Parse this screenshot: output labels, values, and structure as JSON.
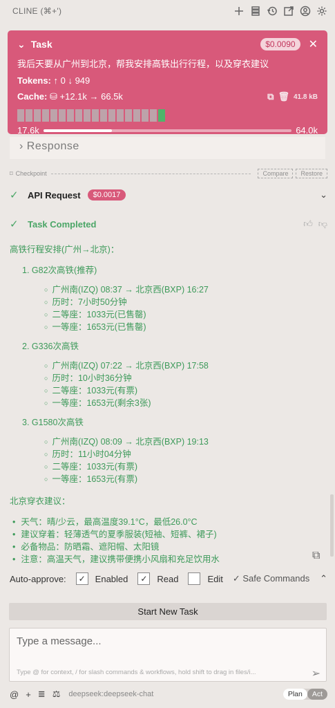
{
  "header": {
    "title": "CLINE (⌘+')"
  },
  "task": {
    "label": "Task",
    "cost": "$0.0090",
    "description": "我后天要从广州到北京，帮我安排高铁出行行程，以及穿衣建议",
    "tokens_label": "Tokens:",
    "tokens_value": "↑ 0 ↓ 949",
    "cache_label": "Cache:",
    "cache_value": "+12.1k → 66.5k",
    "size": "41.8 kB",
    "context_used": "17.6k",
    "context_max": "64.0k",
    "context_fraction": 0.275,
    "blocks": [
      "dim",
      "dim",
      "dim",
      "dim",
      "dim",
      "dim",
      "dim",
      "dim",
      "dim",
      "dim",
      "dim",
      "dim",
      "dim",
      "dim",
      "dim",
      "dim",
      "dim",
      "green"
    ]
  },
  "response": {
    "label": "Response"
  },
  "checkpoint": {
    "label": "Checkpoint",
    "compare": "Compare",
    "restore": "Restore"
  },
  "api_request": {
    "label": "API Request",
    "cost": "$0.0017"
  },
  "completed": {
    "label": "Task Completed"
  },
  "result": {
    "heading": "高铁行程安排(广州→北京)：",
    "trains": [
      {
        "name": "1. G82次高铁(推荐)",
        "items": [
          "广州南(IZQ) 08:37 → 北京西(BXP) 16:27",
          "历时：7小时50分钟",
          "二等座：1033元(已售罄)",
          "一等座：1653元(已售罄)"
        ]
      },
      {
        "name": "2. G336次高铁",
        "items": [
          "广州南(IZQ) 07:22 → 北京西(BXP) 17:58",
          "历时：10小时36分钟",
          "二等座：1033元(有票)",
          "一等座：1653元(剩余3张)"
        ]
      },
      {
        "name": "3. G1580次高铁",
        "items": [
          "广州南(IZQ) 08:09 → 北京西(BXP) 19:13",
          "历时：11小时04分钟",
          "二等座：1033元(有票)",
          "一等座：1653元(有票)"
        ]
      }
    ],
    "wear_heading": "北京穿衣建议：",
    "wear_items": [
      "天气：晴/少云，最高温度39.1°C，最低26.0°C",
      "建议穿着：轻薄透气的夏季服装(短袖、短裤、裙子)",
      "必备物品：防晒霜、遮阳帽、太阳镜",
      "注意：高温天气，建议携带便携小风扇和充足饮用水"
    ]
  },
  "auto_approve": {
    "label": "Auto-approve:",
    "enabled": "Enabled",
    "read": "Read",
    "edit": "Edit",
    "safe": "✓ Safe Commands"
  },
  "new_task": "Start New Task",
  "message": {
    "placeholder": "Type a message...",
    "hint": "Type @ for context, / for slash commands & workflows, hold shift to drag in files/i..."
  },
  "footer": {
    "model": "deepseek:deepseek-chat",
    "plan": "Plan",
    "act": "Act"
  }
}
